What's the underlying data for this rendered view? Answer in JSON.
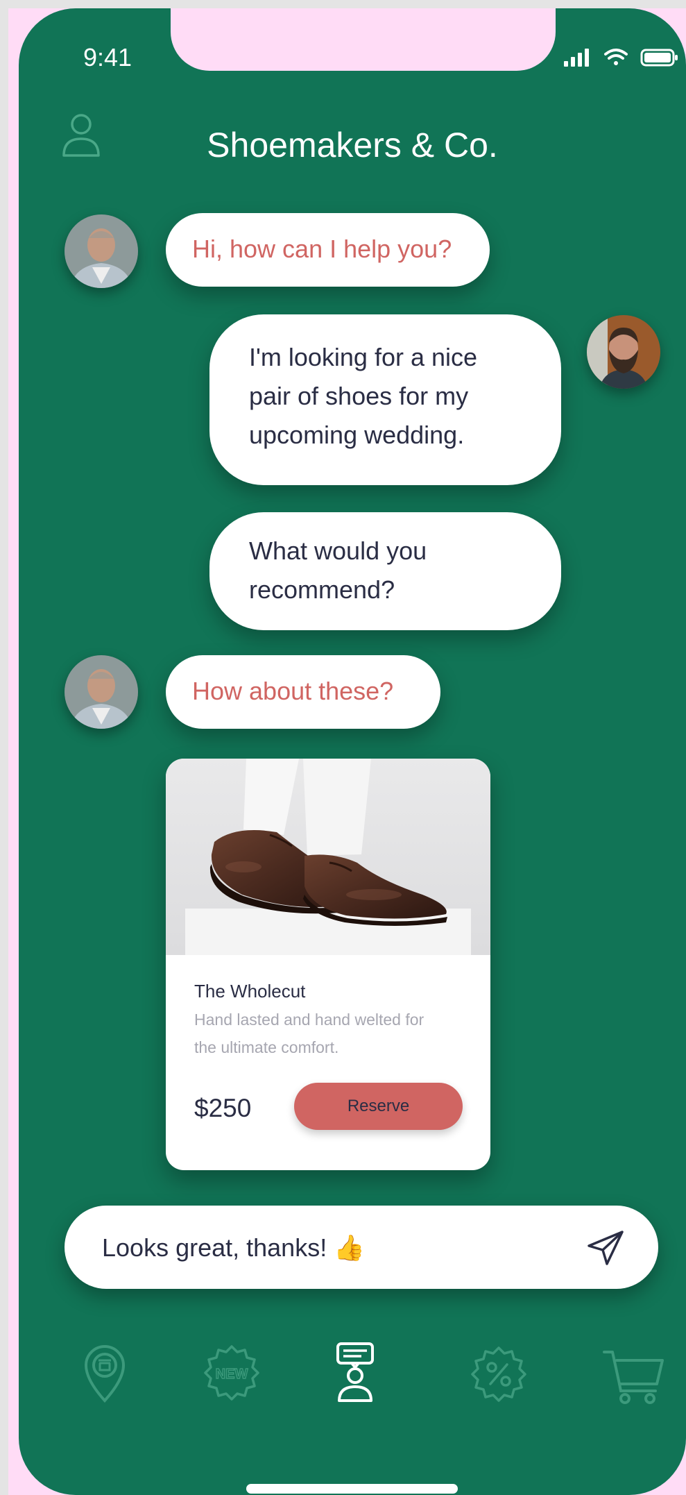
{
  "status_bar": {
    "time": "9:41"
  },
  "header": {
    "title": "Shoemakers & Co."
  },
  "messages": [
    {
      "sender": "agent",
      "text": "Hi, how can I help you?"
    },
    {
      "sender": "user",
      "lines": [
        "I'm looking for a nice",
        "pair of shoes for my",
        "upcoming wedding."
      ]
    },
    {
      "sender": "user",
      "lines": [
        "What would you",
        "recommend?"
      ]
    },
    {
      "sender": "agent",
      "text": "How about these?"
    }
  ],
  "product": {
    "name": "The Wholecut",
    "description_lines": [
      "Hand lasted and hand welted for",
      "the ultimate comfort."
    ],
    "price": "$250",
    "reserve_label": "Reserve"
  },
  "composer": {
    "value": "Looks great, thanks! 👍",
    "send_icon": "paper-plane-icon"
  },
  "bottom_nav": [
    {
      "icon": "store-location-icon",
      "active": false
    },
    {
      "icon": "new-badge-icon",
      "label": "NEW",
      "active": false
    },
    {
      "icon": "chat-support-icon",
      "active": true
    },
    {
      "icon": "discount-badge-icon",
      "active": false
    },
    {
      "icon": "cart-icon",
      "active": false
    }
  ],
  "colors": {
    "background": "#117456",
    "accent": "#d06562",
    "text_dark": "#2a2d44",
    "nav_inactive": "#3c9a7c"
  }
}
